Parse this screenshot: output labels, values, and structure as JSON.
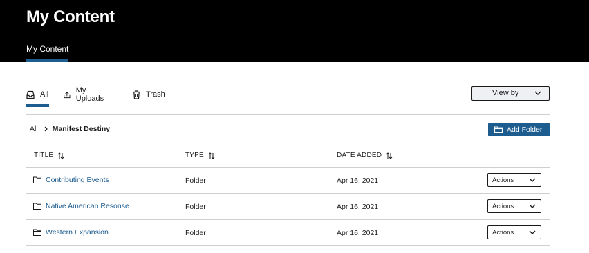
{
  "header": {
    "title": "My Content",
    "tab": "My Content"
  },
  "filter_tabs": [
    {
      "label": "All",
      "icon": "inbox-icon",
      "active": true
    },
    {
      "label": "My Uploads",
      "icon": "upload-icon",
      "active": false
    },
    {
      "label": "Trash",
      "icon": "trash-icon",
      "active": false
    }
  ],
  "view_by": {
    "label": "View by",
    "icon": "chevron-down-icon"
  },
  "breadcrumb": {
    "root": "All",
    "current": "Manifest Destiny"
  },
  "add_folder": {
    "label": "Add Folder",
    "icon": "folder-icon"
  },
  "table": {
    "columns": [
      {
        "label": "TITLE",
        "sortable": true
      },
      {
        "label": "TYPE",
        "sortable": true
      },
      {
        "label": "DATE ADDED",
        "sortable": true
      }
    ],
    "rows": [
      {
        "name": "Contributing Events",
        "type": "Folder",
        "date": "Apr 16, 2021",
        "action": "Actions"
      },
      {
        "name": "Native American Resonse",
        "type": "Folder",
        "date": "Apr 16, 2021",
        "action": "Actions"
      },
      {
        "name": "Western Expansion",
        "type": "Folder",
        "date": "Apr 16, 2021",
        "action": "Actions"
      }
    ]
  },
  "colors": {
    "accent": "#1d5c8f",
    "header_bg": "#000000",
    "divider": "#cfcfcf"
  }
}
